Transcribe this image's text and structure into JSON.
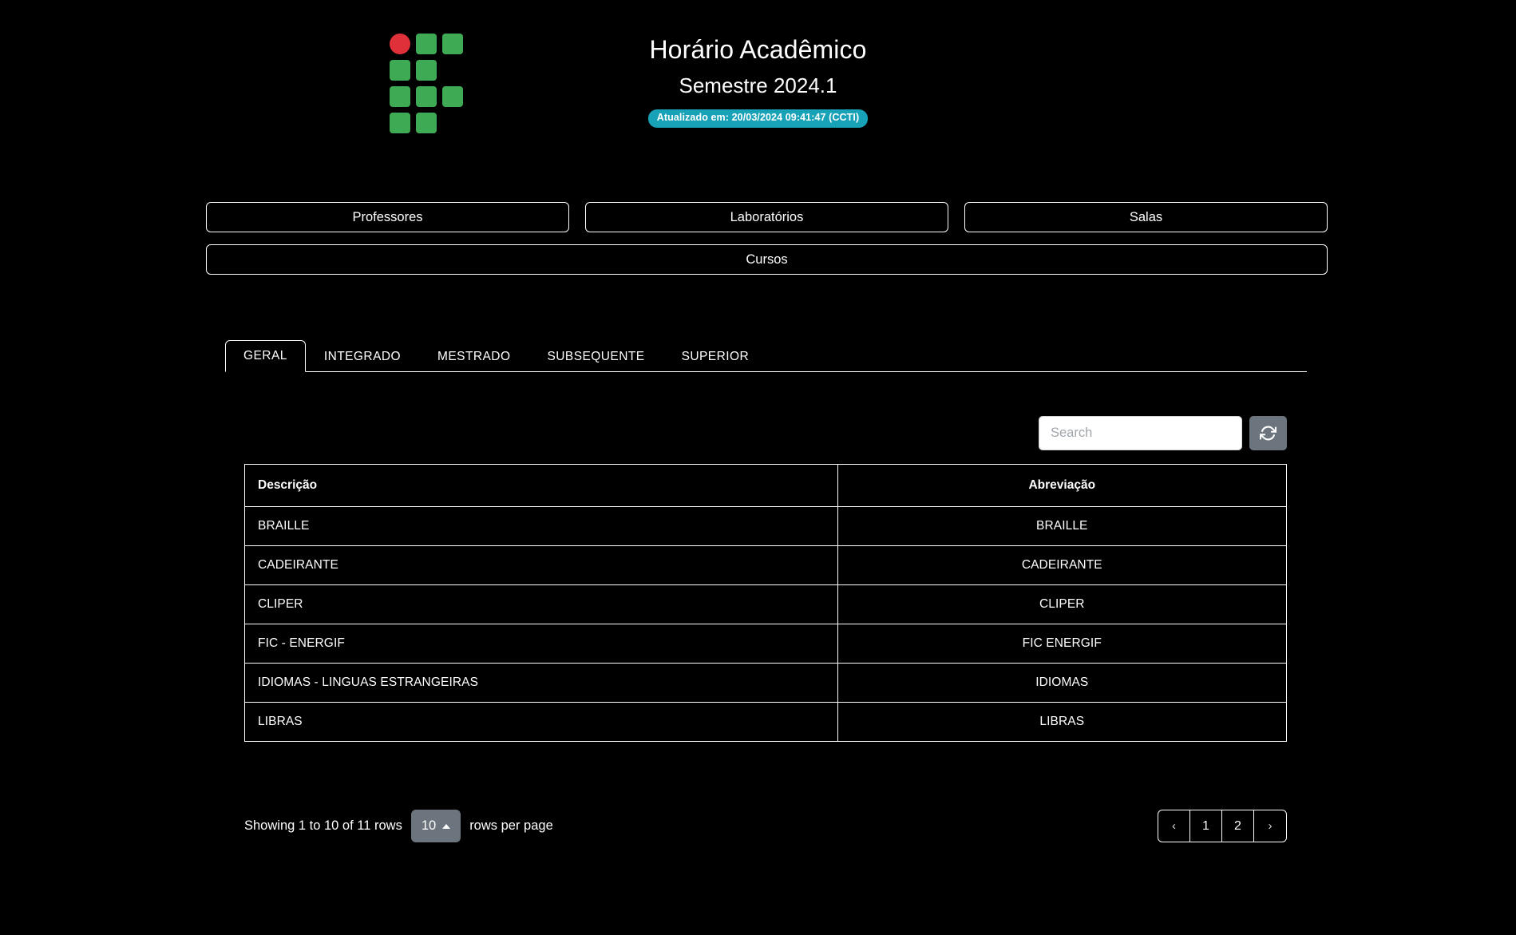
{
  "header": {
    "logo_name": "if-institutional-logo",
    "title": "Horário Acadêmico",
    "subtitle": "Semestre 2024.1",
    "badge": "Atualizado em: 20/03/2024 09:41:47 (CCTI)",
    "badge_color": "#17a2b8"
  },
  "nav_buttons": {
    "row1": [
      {
        "label": "Professores"
      },
      {
        "label": "Laboratórios"
      },
      {
        "label": "Salas"
      }
    ],
    "row2": [
      {
        "label": "Cursos"
      }
    ]
  },
  "tabs": [
    {
      "label": "GERAL",
      "active": true
    },
    {
      "label": "INTEGRADO",
      "active": false
    },
    {
      "label": "MESTRADO",
      "active": false
    },
    {
      "label": "SUBSEQUENTE",
      "active": false
    },
    {
      "label": "SUPERIOR",
      "active": false
    }
  ],
  "toolbar": {
    "search_placeholder": "Search",
    "search_value": "",
    "refresh_icon": "refresh-sync-icon",
    "refresh_color": "#6c757d"
  },
  "table": {
    "columns": [
      "Descrição",
      "Abreviação"
    ],
    "rows": [
      {
        "descricao": "BRAILLE",
        "abreviacao": "BRAILLE"
      },
      {
        "descricao": "CADEIRANTE",
        "abreviacao": "CADEIRANTE"
      },
      {
        "descricao": "CLIPER",
        "abreviacao": "CLIPER"
      },
      {
        "descricao": "FIC - ENERGIF",
        "abreviacao": "FIC ENERGIF"
      },
      {
        "descricao": "IDIOMAS - LINGUAS ESTRANGEIRAS",
        "abreviacao": "IDIOMAS"
      },
      {
        "descricao": "LIBRAS",
        "abreviacao": "LIBRAS"
      }
    ]
  },
  "footer": {
    "showing_text": "Showing 1 to 10 of 11 rows",
    "page_size_value": "10",
    "rows_per_page_label": "rows per page",
    "pagination": [
      {
        "label": "‹",
        "kind": "arrow",
        "name": "prev"
      },
      {
        "label": "1",
        "kind": "page",
        "name": "page-1"
      },
      {
        "label": "2",
        "kind": "page",
        "name": "page-2"
      },
      {
        "label": "›",
        "kind": "arrow",
        "name": "next"
      }
    ]
  }
}
